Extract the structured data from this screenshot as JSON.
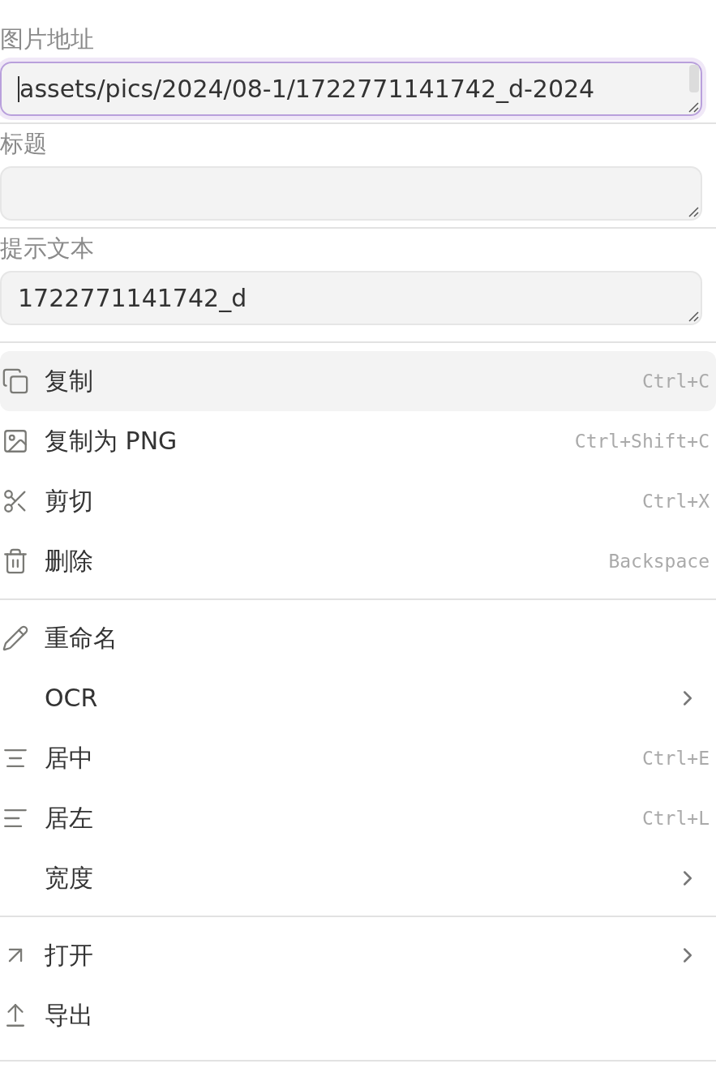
{
  "fields": [
    {
      "label": "图片地址",
      "value": "assets/pics/2024/08-1/1722771141742_d-2024",
      "focused": true
    },
    {
      "label": "标题",
      "focused": false
    },
    {
      "label": "提示文本",
      "value": "1722771141742_d",
      "focused": false
    }
  ],
  "menu_groups": [
    [
      {
        "label": "复制",
        "shortcut": "Ctrl+C",
        "submenu": false,
        "selected": true
      },
      {
        "label": "复制为 PNG",
        "shortcut": "Ctrl+Shift+C",
        "submenu": false,
        "selected": false
      },
      {
        "label": "剪切",
        "shortcut": "Ctrl+X",
        "submenu": false,
        "selected": false
      },
      {
        "label": "删除",
        "shortcut": "Backspace",
        "submenu": false,
        "selected": false
      }
    ],
    [
      {
        "label": "重命名",
        "submenu": false,
        "selected": false
      },
      {
        "label": "OCR",
        "submenu": true,
        "selected": false
      },
      {
        "label": "居中",
        "shortcut": "Ctrl+E",
        "submenu": false,
        "selected": false
      },
      {
        "label": "居左",
        "shortcut": "Ctrl+L",
        "submenu": false,
        "selected": false
      },
      {
        "label": "宽度",
        "submenu": true,
        "selected": false
      }
    ],
    [
      {
        "label": "打开",
        "submenu": true,
        "selected": false
      },
      {
        "label": "导出",
        "submenu": false,
        "selected": false
      }
    ]
  ]
}
